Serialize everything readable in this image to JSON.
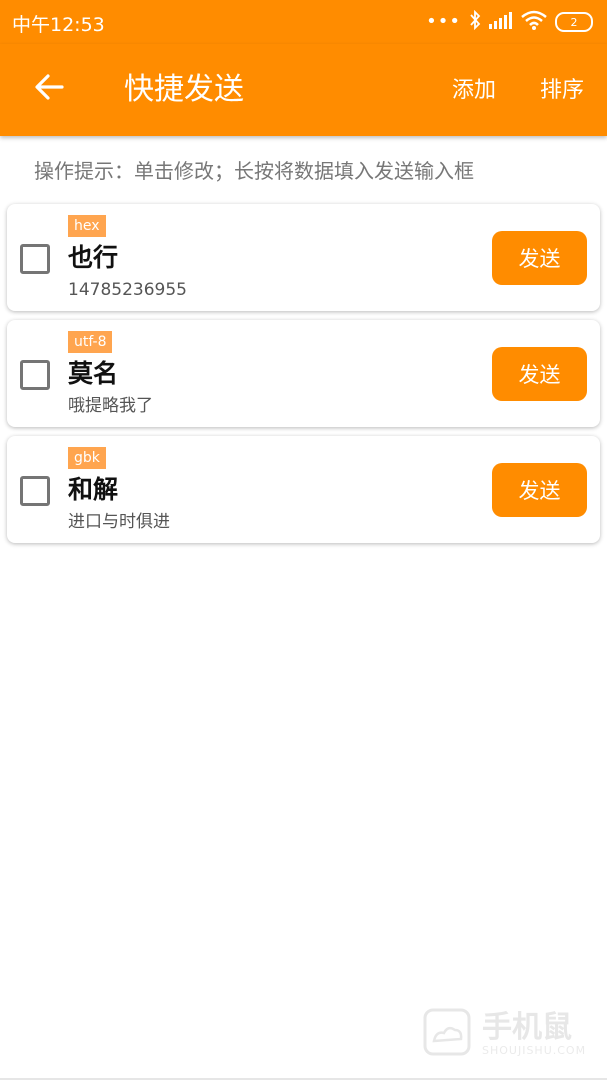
{
  "status_bar": {
    "time": "中午12:53",
    "dots": "•••",
    "battery": "2"
  },
  "app_bar": {
    "back_icon": "arrow-left-icon",
    "title": "快捷发送",
    "add_label": "添加",
    "sort_label": "排序"
  },
  "hint": "操作提示：单击修改；长按将数据填入发送输入框",
  "items": [
    {
      "encoding": "hex",
      "name": "也行",
      "content": "14785236955",
      "send_label": "发送",
      "checked": false
    },
    {
      "encoding": "utf-8",
      "name": "莫名",
      "content": "哦提略我了",
      "send_label": "发送",
      "checked": false
    },
    {
      "encoding": "gbk",
      "name": "和解",
      "content": "进口与时俱进",
      "send_label": "发送",
      "checked": false
    }
  ],
  "watermark": {
    "text": "手机鼠",
    "sub": "SHOUJISHU.COM"
  },
  "colors": {
    "primary": "#FF8C00",
    "tag": "#FFA54F",
    "hint": "#777777"
  }
}
